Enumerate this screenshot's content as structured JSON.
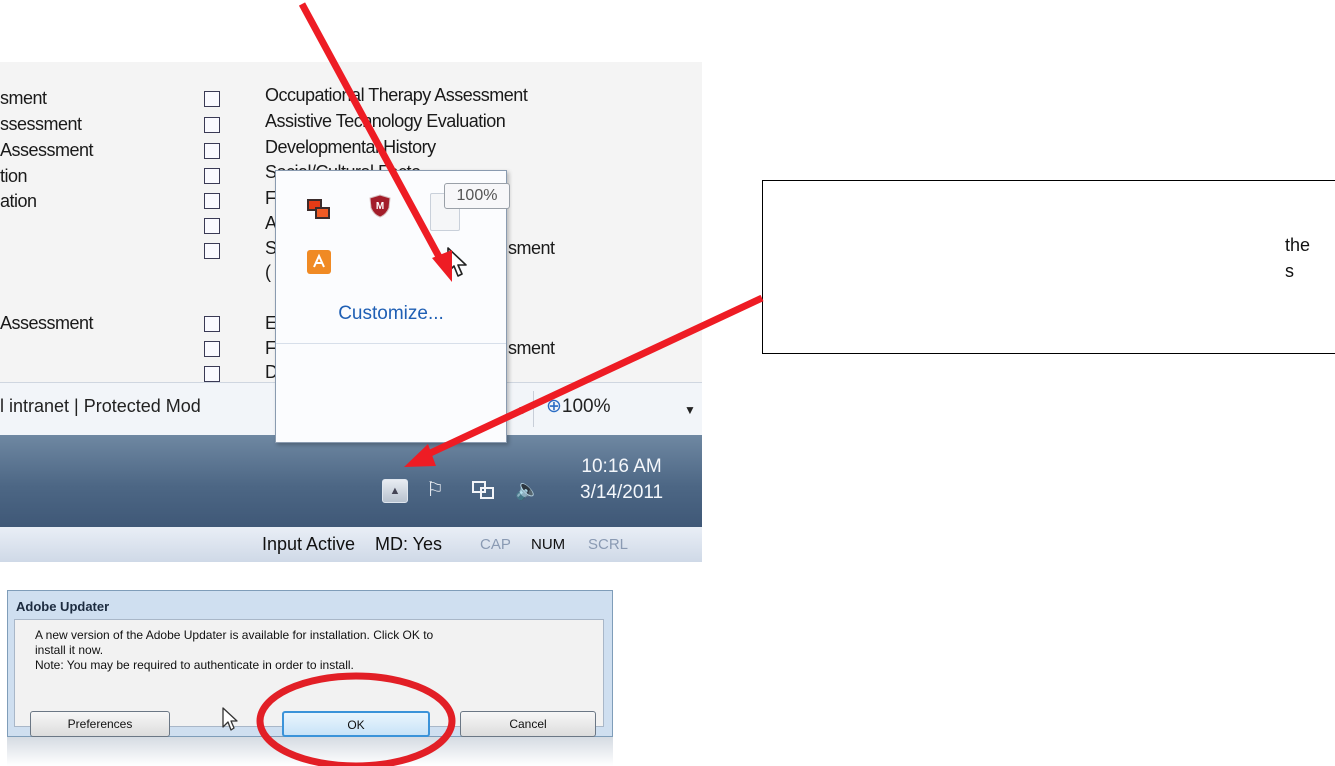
{
  "form": {
    "left_items": [
      "sment",
      "ssessment",
      "Assessment",
      "tion",
      "ation",
      "Assessment"
    ],
    "right_items": [
      "Occupational Therapy Assessment",
      "Assistive Technology Evaluation",
      "Developmental History",
      "Social/Cultural Facto",
      "F",
      "A",
      "S",
      "sment",
      "(",
      "E",
      "F",
      "sment",
      "D"
    ]
  },
  "ie_status": {
    "zone_text": "l intranet | Protected Mod",
    "zoom": "100%"
  },
  "tray_popup": {
    "tooltip": "100%",
    "customize_label": "Customize...",
    "icons": [
      "network-monitors-icon",
      "mcafee-shield-icon",
      "volume-hidden-icon",
      "adobe-updater-icon"
    ]
  },
  "taskbar": {
    "time": "10:16 AM",
    "date": "3/14/2011",
    "icons": [
      "show-hidden-icons-button",
      "flag-icon",
      "network-icon",
      "speaker-icon"
    ]
  },
  "status_bar": {
    "input_active": "Input Active",
    "md": "MD: Yes",
    "cap": "CAP",
    "num": "NUM",
    "scrl": "SCRL"
  },
  "dialog": {
    "title": "Adobe Updater",
    "line1": "A new version of the Adobe Updater is available for installation. Click OK to",
    "line2": "install it now.",
    "line3": "Note: You may be required to authenticate in order to install.",
    "preferences_label": "Preferences",
    "ok_label": "OK",
    "cancel_label": "Cancel"
  },
  "callout": {
    "fragment1": "the",
    "fragment2": "s"
  },
  "colors": {
    "arrow": "#ee1c24",
    "link_blue": "#1f5fb4",
    "taskbar": "#4d6785"
  }
}
